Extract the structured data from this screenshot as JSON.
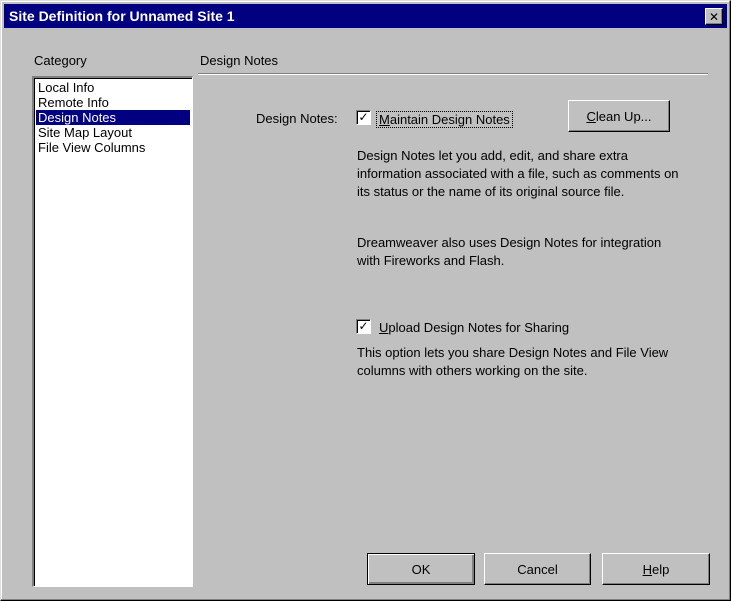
{
  "window": {
    "title": "Site Definition for Unnamed Site 1",
    "close_glyph": "✕"
  },
  "sidebar": {
    "label": "Category",
    "items": [
      {
        "label": "Local Info",
        "selected": false
      },
      {
        "label": "Remote Info",
        "selected": false
      },
      {
        "label": "Design Notes",
        "selected": true
      },
      {
        "label": "Site Map Layout",
        "selected": false
      },
      {
        "label": "File View Columns",
        "selected": false
      }
    ]
  },
  "main": {
    "section_title": "Design Notes",
    "field_label": "Design Notes:",
    "maintain_checkbox": {
      "checked": true,
      "mnemonic": "M",
      "label_rest": "aintain Design Notes"
    },
    "cleanup_button": {
      "mnemonic": "C",
      "label_rest": "lean Up..."
    },
    "description1": "Design Notes let you add, edit, and share extra information associated with a file, such as comments on its status or the name of its original source file.",
    "description2": "Dreamweaver also uses Design Notes for integration with Fireworks and Flash.",
    "upload_checkbox": {
      "checked": true,
      "mnemonic": "U",
      "label_rest": "pload Design Notes for Sharing"
    },
    "description3": "This option lets you share Design Notes and File View columns with others working on the site."
  },
  "footer": {
    "ok_label": "OK",
    "cancel_label": "Cancel",
    "help": {
      "mnemonic": "H",
      "label_rest": "elp"
    }
  },
  "colors": {
    "titlebar": "#000080",
    "face": "#c0c0c0",
    "selection": "#000080"
  },
  "check_glyph": "✓"
}
